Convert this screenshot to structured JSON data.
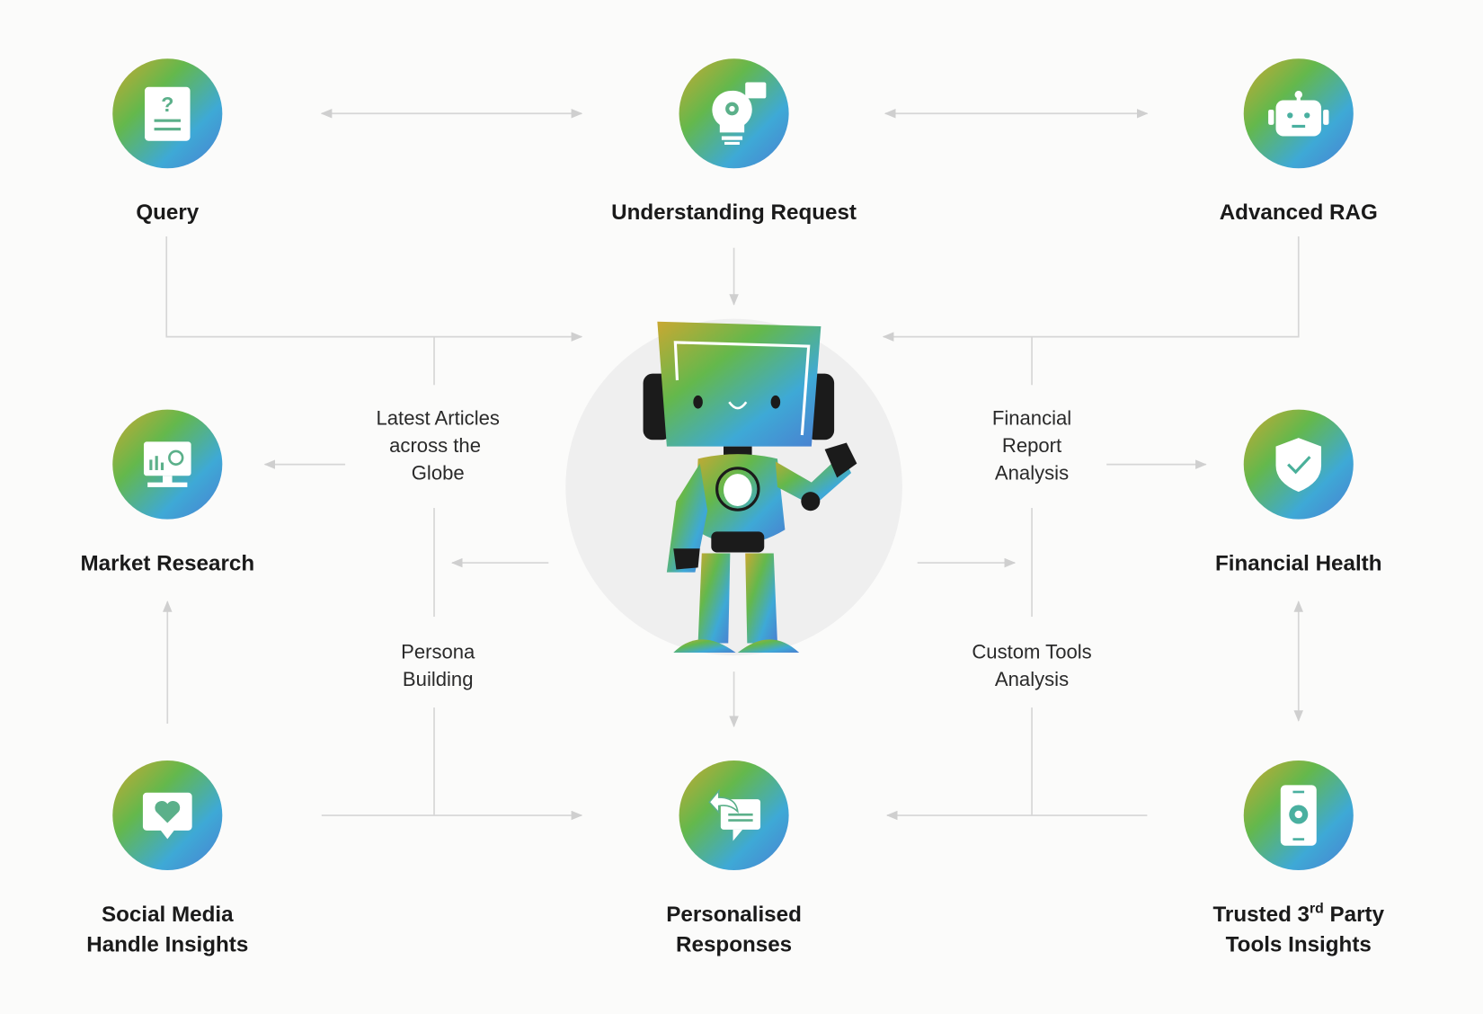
{
  "colors": {
    "gradient_start": "#c3a934",
    "gradient_mid": "#62b94e",
    "gradient_end": "#3aa5dc",
    "line": "#d6d6d6",
    "halo": "#efefef"
  },
  "nodes": {
    "query": {
      "title": "Query",
      "icon": "question-document-icon"
    },
    "understanding": {
      "title": "Understanding Request",
      "icon": "lightbulb-gear-chat-icon"
    },
    "rag": {
      "title": "Advanced RAG",
      "icon": "robot-head-icon"
    },
    "market": {
      "title": "Market Research",
      "icon": "monitor-chart-search-icon"
    },
    "health": {
      "title": "Financial Health",
      "icon": "shield-check-icon"
    },
    "social": {
      "title_line1": "Social Media",
      "title_line2": "Handle Insights",
      "icon": "heart-speech-bubble-icon"
    },
    "personalised": {
      "title_line1": "Personalised",
      "title_line2": "Responses",
      "icon": "reply-chat-icon"
    },
    "trusted": {
      "title_line1_pre": "Trusted 3",
      "title_line1_sup": "rd",
      "title_line1_post": " Party",
      "title_line2": "Tools Insights",
      "icon": "phone-gear-icon"
    }
  },
  "edge_labels": {
    "articles": [
      "Latest Articles",
      "across the",
      "Globe"
    ],
    "persona": [
      "Persona",
      "Building"
    ],
    "financial_report": [
      "Financial",
      "Report",
      "Analysis"
    ],
    "custom_tools": [
      "Custom Tools",
      "Analysis"
    ]
  },
  "center": {
    "icon": "waving-robot-mascot"
  }
}
